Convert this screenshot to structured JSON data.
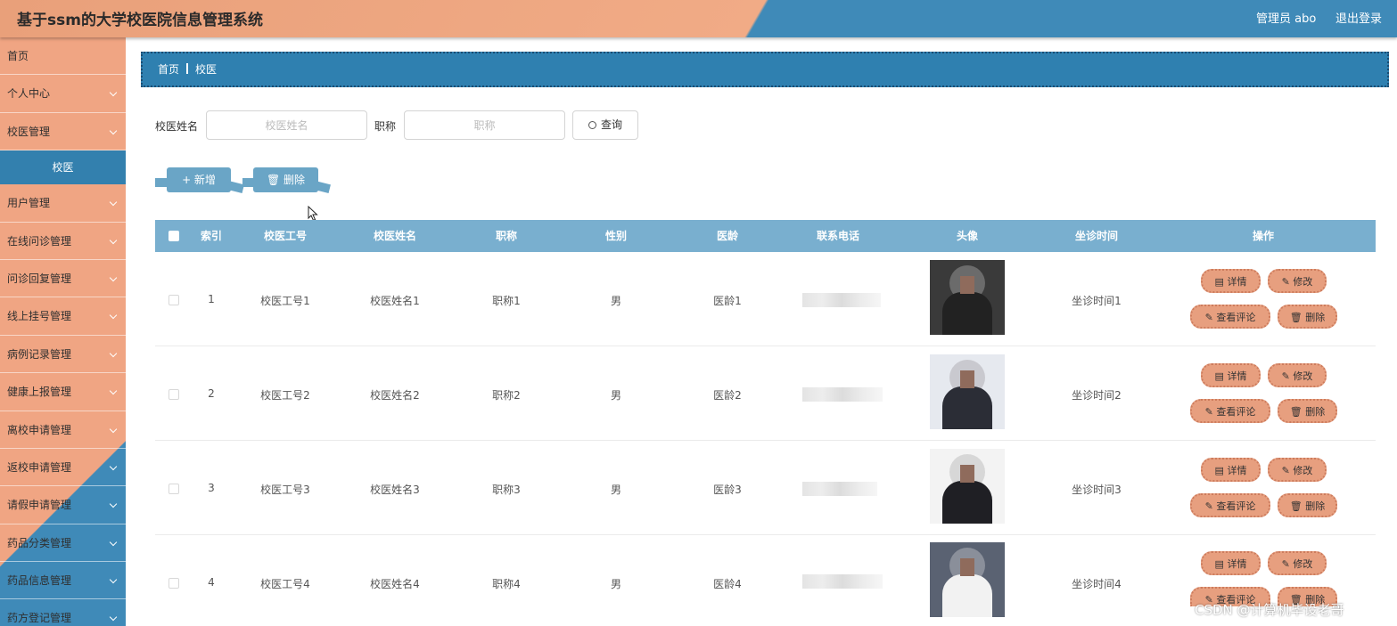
{
  "header": {
    "title": "基于ssm的大学校医院信息管理系统",
    "user": "管理员 abo",
    "logout": "退出登录"
  },
  "sidebar": {
    "items": [
      {
        "label": "首页",
        "chevron": false
      },
      {
        "label": "个人中心",
        "chevron": true
      },
      {
        "label": "校医管理",
        "chevron": true
      },
      {
        "label": "校医",
        "sub": true
      },
      {
        "label": "用户管理",
        "chevron": true
      },
      {
        "label": "在线问诊管理",
        "chevron": true
      },
      {
        "label": "问诊回复管理",
        "chevron": true
      },
      {
        "label": "线上挂号管理",
        "chevron": true
      },
      {
        "label": "病例记录管理",
        "chevron": true
      },
      {
        "label": "健康上报管理",
        "chevron": true
      },
      {
        "label": "离校申请管理",
        "chevron": true
      },
      {
        "label": "返校申请管理",
        "chevron": true
      },
      {
        "label": "请假申请管理",
        "chevron": true
      },
      {
        "label": "药品分类管理",
        "chevron": true
      },
      {
        "label": "药品信息管理",
        "chevron": true
      },
      {
        "label": "药方登记管理",
        "chevron": true
      }
    ]
  },
  "breadcrumb": {
    "home": "首页",
    "current": "校医"
  },
  "search": {
    "name_label": "校医姓名",
    "name_placeholder": "校医姓名",
    "title_label": "职称",
    "title_placeholder": "职称",
    "query_button": "查询"
  },
  "actions": {
    "add": "+ 新增",
    "delete": "删除"
  },
  "table": {
    "columns": [
      "索引",
      "校医工号",
      "校医姓名",
      "职称",
      "性别",
      "医龄",
      "联系电话",
      "头像",
      "坐诊时间",
      "操作"
    ],
    "rows": [
      {
        "index": "1",
        "id": "校医工号1",
        "name": "校医姓名1",
        "title": "职称1",
        "gender": "男",
        "years": "医龄1",
        "time": "坐诊时间1"
      },
      {
        "index": "2",
        "id": "校医工号2",
        "name": "校医姓名2",
        "title": "职称2",
        "gender": "男",
        "years": "医龄2",
        "time": "坐诊时间2"
      },
      {
        "index": "3",
        "id": "校医工号3",
        "name": "校医姓名3",
        "title": "职称3",
        "gender": "男",
        "years": "医龄3",
        "time": "坐诊时间3"
      },
      {
        "index": "4",
        "id": "校医工号4",
        "name": "校医姓名4",
        "title": "职称4",
        "gender": "男",
        "years": "医龄4",
        "time": "坐诊时间4"
      }
    ],
    "row_actions": {
      "detail": "详情",
      "edit": "修改",
      "comments": "查看评论",
      "delete": "删除"
    }
  },
  "watermark": "CSDN @计算机毕设老哥",
  "colors": {
    "header_left": "#f1ab86",
    "header_right": "#3f8ab8",
    "sidebar": "#f0a583",
    "breadcrumb": "#2f80b0",
    "table_head": "#79afcf",
    "op_button": "#e79f7f",
    "action_button": "#6aa5c6"
  }
}
